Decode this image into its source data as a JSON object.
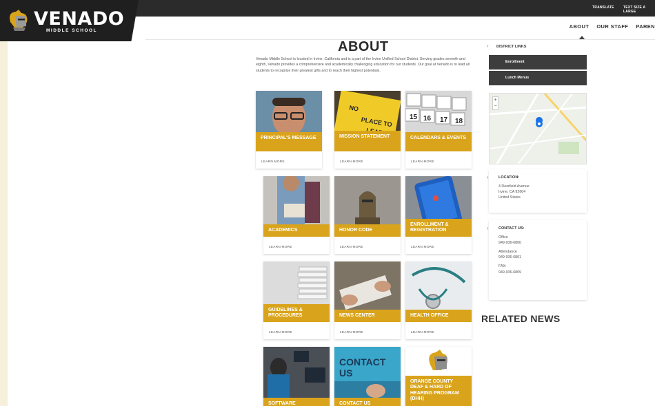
{
  "topbar": {
    "translate": "TRANSLATE",
    "text_size": "TEXT SIZE A LARGE"
  },
  "logo": {
    "name": "VENADO",
    "sub": "MIDDLE SCHOOL"
  },
  "nav": {
    "items": [
      "ABOUT",
      "OUR STAFF",
      "PAREN"
    ]
  },
  "page": {
    "title": "ABOUT",
    "intro": "Venado Middle School is located in Irvine, California and is a part of the Irvine Unified School District. Serving grades seventh and eighth, Venado provides a comprehensive and academically challenging education for our students. Our goal at Venado is to lead all students to recognize their greatest gifts and to reach their highest potentials."
  },
  "cards": [
    {
      "label": "PRINCIPAL'S MESSAGE",
      "more": "LEARN MORE"
    },
    {
      "label": "MISSION STATEMENT",
      "more": "LEARN MORE"
    },
    {
      "label": "CALENDARS & EVENTS",
      "more": "LEARN MORE"
    },
    {
      "label": "ACADEMICS",
      "more": "LEARN MORE"
    },
    {
      "label": "HONOR CODE",
      "more": "LEARN MORE"
    },
    {
      "label": "ENROLLMENT & REGISTRATION",
      "more": "LEARN MORE"
    },
    {
      "label": "GUIDELINES & PROCEDURES",
      "more": "LEARN MORE"
    },
    {
      "label": "NEWS CENTER",
      "more": "LEARN MORE"
    },
    {
      "label": "HEALTH OFFICE",
      "more": "LEARN MORE"
    },
    {
      "label": "SOFTWARE",
      "more": ""
    },
    {
      "label": "CONTACT US",
      "more": "",
      "img_text": "CONTACT US"
    },
    {
      "label": "ORANGE COUNTY DEAF & HARD OF HEARING PROGRAM (DHH)",
      "more": ""
    }
  ],
  "sidebar": {
    "district_links": "DISTRICT LINKS",
    "links": [
      "Enrollment",
      "Lunch Menus"
    ],
    "location": {
      "heading": "LOCATION:",
      "lines": [
        "4 Deerfield Avenue",
        "Irvine, CA 92604",
        "United States"
      ]
    },
    "contact": {
      "heading": "CONTACT US:",
      "office_label": "Office",
      "office": "949-936-6800",
      "attendance_label": "Attendance",
      "attendance": "949-936-6801",
      "fax_label": "FAX:",
      "fax": "949-936-6809"
    }
  },
  "related": "RELATED NEWS",
  "colors": {
    "accent": "#d9a41b",
    "dark": "#2b2b2b",
    "outer": "#f6efd9"
  }
}
